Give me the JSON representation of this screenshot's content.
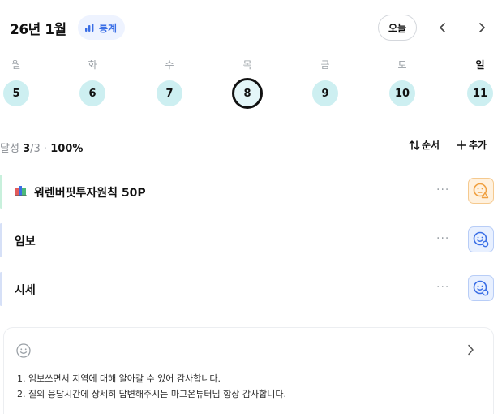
{
  "header": {
    "month": "26년 1월",
    "stats_label": "통계",
    "today_label": "오늘",
    "prev_icon": "chevron-left",
    "next_icon": "chevron-right"
  },
  "week": {
    "weekdays": [
      "월",
      "화",
      "수",
      "목",
      "금",
      "토",
      "일"
    ],
    "days": [
      "5",
      "6",
      "7",
      "8",
      "9",
      "10",
      "11"
    ],
    "selected_index": 3
  },
  "summary": {
    "label": "달성",
    "done": "3",
    "total": "/3",
    "separator": "·",
    "percent": "100%",
    "sort_label": "순서",
    "add_label": "추가"
  },
  "habits": [
    {
      "name": "워렌버핏투자원칙 50P",
      "more": "···",
      "mood": "warn",
      "bar_color": "#c8f0dc",
      "icon": "books-icon"
    },
    {
      "name": "임보",
      "more": "···",
      "mood": "ok",
      "bar_color": "#d6e0f7",
      "icon": ""
    },
    {
      "name": "시세",
      "more": "···",
      "mood": "ok",
      "bar_color": "#d6e0f7",
      "icon": ""
    }
  ],
  "memo": {
    "lines": [
      "1. 임보쓰면서 지역에 대해 알아갈 수 있어 감사합니다.",
      "2. 질의 응답시간에 상세히 답변해주시는 마그온튜터님 항상 감사합니다."
    ]
  },
  "colors": {
    "accent": "#3b6fe6",
    "day_bg": "#cdeff1",
    "warn": "#f0a040",
    "ok": "#3b6fe6"
  }
}
